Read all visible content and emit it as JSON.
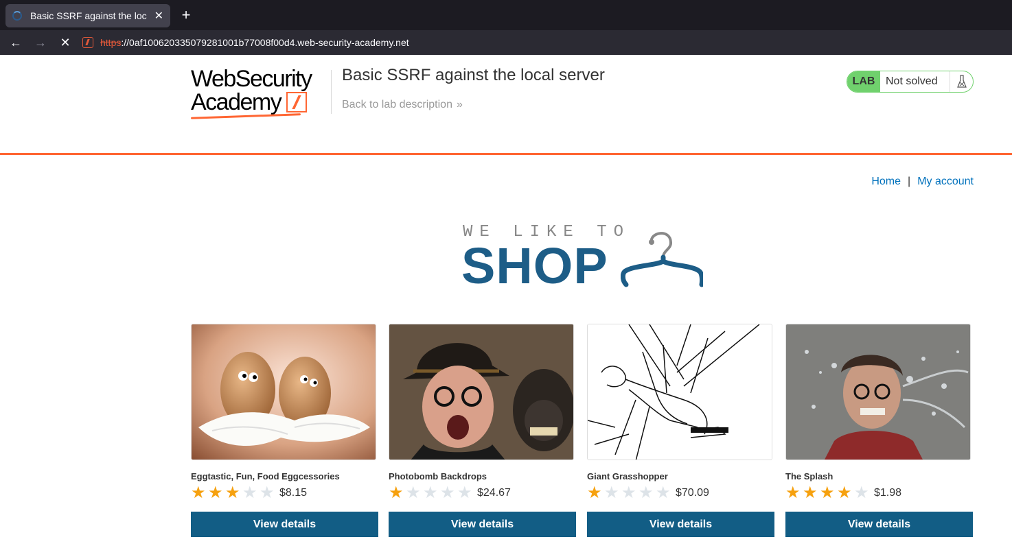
{
  "browser": {
    "tab_title": "Basic SSRF against the loc",
    "url_scheme": "https",
    "url_rest": "://0af100620335079281001b77008f00d4.web-security-academy.net"
  },
  "header": {
    "logo_line1": "WebSecurity",
    "logo_line2": "Academy",
    "lab_title": "Basic SSRF against the local server",
    "back_link": "Back to lab description",
    "badge_lab": "LAB",
    "badge_status": "Not solved",
    "accent_color": "#ff6633"
  },
  "nav": {
    "home": "Home",
    "separator": "|",
    "account": "My account"
  },
  "shop_logo": {
    "small": "WE LIKE TO",
    "big": "SHOP"
  },
  "products": [
    {
      "name": "Eggtastic, Fun, Food Eggcessories",
      "rating": 3,
      "price": "$8.15",
      "button": "View details"
    },
    {
      "name": "Photobomb Backdrops",
      "rating": 1,
      "price": "$24.67",
      "button": "View details"
    },
    {
      "name": "Giant Grasshopper",
      "rating": 1,
      "price": "$70.09",
      "button": "View details"
    },
    {
      "name": "The Splash",
      "rating": 4,
      "price": "$1.98",
      "button": "View details"
    }
  ]
}
